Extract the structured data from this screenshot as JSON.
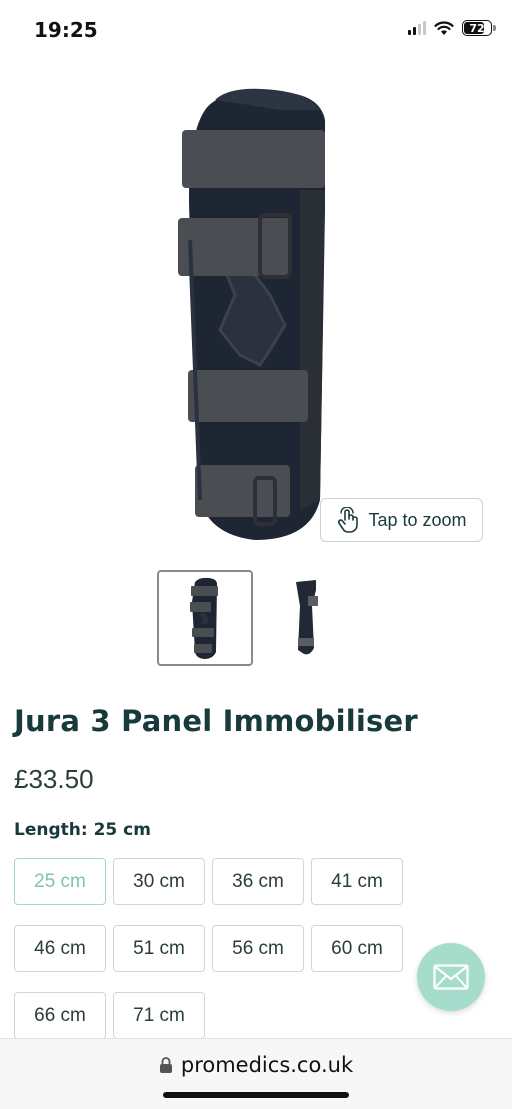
{
  "status_bar": {
    "time": "19:25",
    "battery_level": "72",
    "icons": [
      "signal-icon",
      "wifi-icon",
      "battery-icon"
    ]
  },
  "gallery": {
    "zoom_label": "Tap to zoom",
    "thumbnails": [
      "front-view",
      "side-view"
    ],
    "active_thumbnail": 0
  },
  "product": {
    "title": "Jura 3 Panel Immobiliser",
    "price": "£33.50",
    "option_label": "Length: 25 cm",
    "sizes": [
      "25 cm",
      "30 cm",
      "36 cm",
      "41 cm",
      "46 cm",
      "51 cm",
      "56 cm",
      "60 cm",
      "66 cm",
      "71 cm"
    ],
    "selected_size": "25 cm"
  },
  "browser": {
    "url": "promedics.co.uk"
  },
  "colors": {
    "brand_dark": "#183a3a",
    "accent_mint": "#a6dccc",
    "selected_text": "#7fc2b4"
  }
}
